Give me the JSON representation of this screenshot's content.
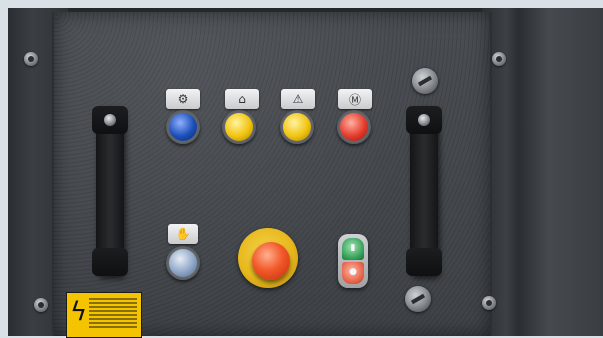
{
  "scene": {
    "description_visible": "",
    "lamps": [
      {
        "color": "#1b4fb8"
      },
      {
        "color": "#f1c40f"
      },
      {
        "color": "#f1c40f"
      },
      {
        "color": "#e53b2c"
      }
    ],
    "estop_color": "#e8b81d",
    "warning_color": "#f5c400"
  }
}
